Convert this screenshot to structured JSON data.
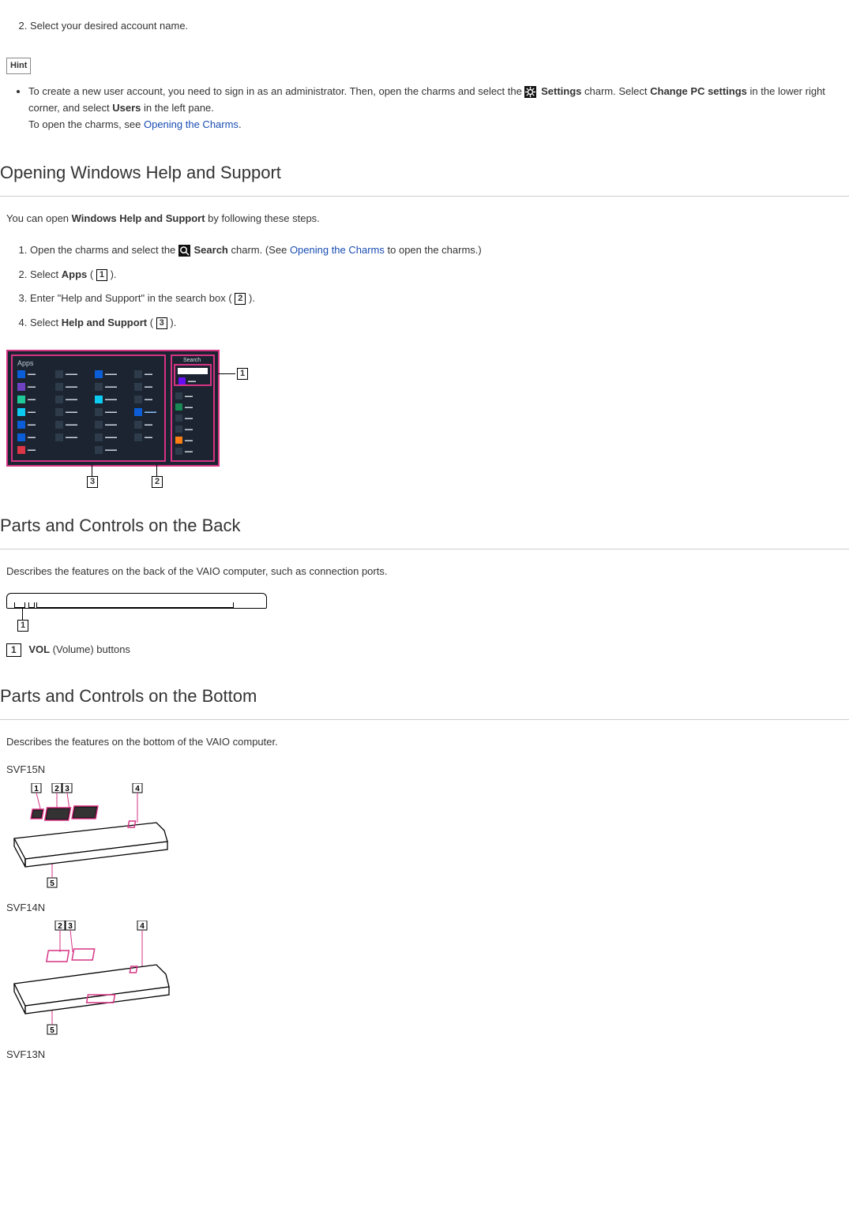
{
  "step2": "Select your desired account name.",
  "hint": {
    "label": "Hint",
    "text_a": "To create a new user account, you need to sign in as an administrator. Then, open the charms and select the ",
    "settings": "Settings",
    "text_b": " charm. Select ",
    "change_pc": "Change PC settings",
    "text_c": " in the lower right corner, and select ",
    "users": "Users",
    "text_d": " in the left pane.",
    "open_charms_prefix": "To open the charms, see ",
    "open_charms_link": "Opening the Charms",
    "period": "."
  },
  "sec1": {
    "title": "Opening Windows Help and Support",
    "intro_a": "You can open ",
    "intro_b": "Windows Help and Support",
    "intro_c": " by following these steps.",
    "s1_a": "Open the charms and select the ",
    "s1_search": "Search",
    "s1_b": " charm. (See ",
    "s1_link": "Opening the Charms",
    "s1_c": " to open the charms.)",
    "s2_a": "Select ",
    "s2_apps": "Apps",
    "s2_b": " ( ",
    "s2_c": " ).",
    "s3_a": "Enter \"Help and Support\" in the search box ( ",
    "s3_b": " ).",
    "s4_a": "Select ",
    "s4_has": "Help and Support",
    "s4_b": " ( ",
    "s4_c": " ).",
    "apps_header": "Apps",
    "search_header": "Search"
  },
  "sec2": {
    "title": "Parts and Controls on the Back",
    "intro": "Describes the features on the back of the VAIO computer, such as connection ports.",
    "item_a": "VOL",
    "item_b": " (Volume) buttons"
  },
  "sec3": {
    "title": "Parts and Controls on the Bottom",
    "intro": "Describes the features on the bottom of the VAIO computer.",
    "model1": "SVF15N",
    "model2": "SVF14N",
    "model3": "SVF13N"
  },
  "nums": {
    "n1": "1",
    "n2": "2",
    "n3": "3",
    "n4": "4",
    "n5": "5"
  }
}
